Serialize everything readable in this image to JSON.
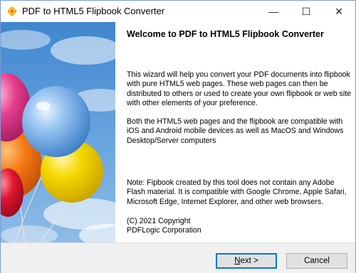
{
  "window": {
    "title": "PDF to HTML5 Flipbook Converter",
    "minimize_glyph": "—",
    "maximize_glyph": "☐",
    "close_glyph": "✕",
    "icon": "app-flower-icon",
    "accent_color": "#0078d7"
  },
  "content": {
    "heading": "Welcome to PDF to HTML5 Flipbook Converter",
    "paragraph_1": "This wizard will help you convert your PDF documents into flipbook with pure HTML5 web pages. These web pages can then be distributed to others or used to create your own flipbook or web site with other elements of your preference.",
    "paragraph_2": "Both the HTML5 web pages and the flipbook are compatible with iOS and Android mobile devices as well as MacOS and Windows Desktop/Server computers",
    "paragraph_3": "Note: Fipbook created by this tool does not contain any Adobe Flash material. It is compatible with Google Chrome, Apple Safari, Microsoft Edge, Internet Explorer, and other web browsers.",
    "copyright_line": "(C) 2021 Copyright",
    "company_line": "PDFLogic Corporation"
  },
  "buttons": {
    "next_mnemonic": "N",
    "next_rest": "ext >",
    "cancel": "Cancel"
  }
}
